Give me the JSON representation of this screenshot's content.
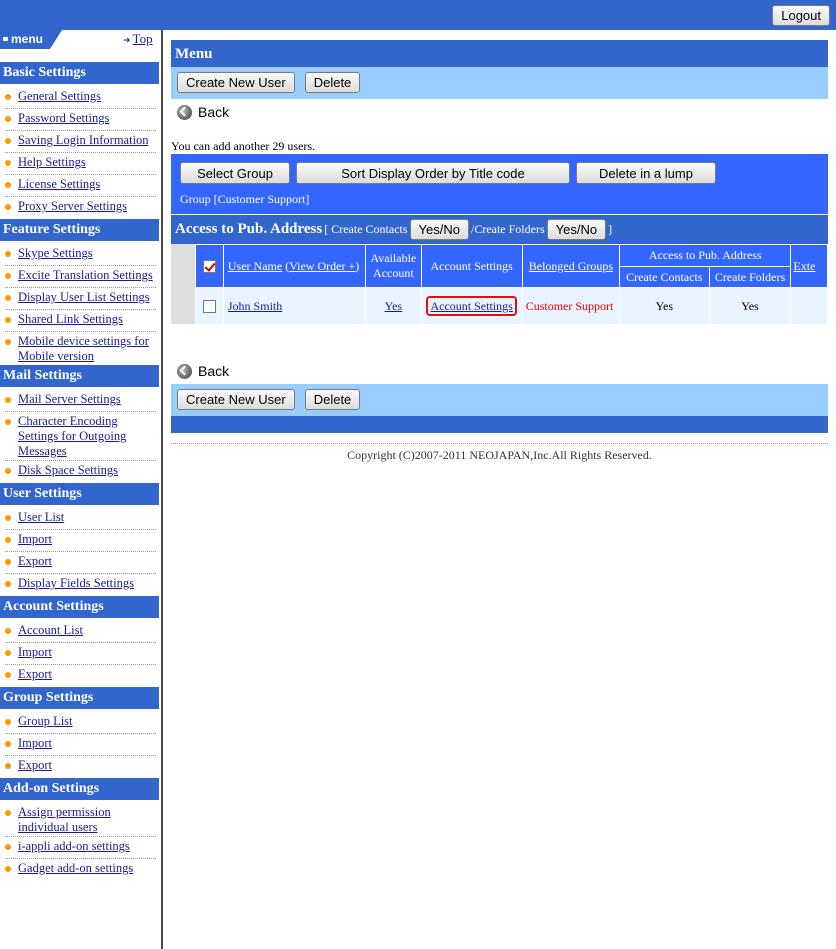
{
  "header": {
    "logout_label": "Logout"
  },
  "sidebar": {
    "menu_label": "menu",
    "top_link": "Top",
    "sections": [
      {
        "title": "Basic Settings",
        "items": [
          "General Settings",
          "Password Settings",
          "Saving Login Information",
          "Help Settings",
          "License Settings",
          "Proxy Server Settings"
        ]
      },
      {
        "title": "Feature Settings",
        "items": [
          "Skype Settings",
          "Excite Translation Settings",
          "Display User List Settings",
          "Shared Link Settings",
          "Mobile device settings for Mobile version"
        ]
      },
      {
        "title": "Mail Settings",
        "items": [
          "Mail Server Settings",
          "Character Encoding Settings for Outgoing Messages",
          "Disk Space Settings"
        ]
      },
      {
        "title": "User Settings",
        "items": [
          "User List",
          "Import",
          "Export",
          "Display Fields Settings"
        ]
      },
      {
        "title": "Account Settings",
        "items": [
          "Account List",
          "Import",
          "Export"
        ]
      },
      {
        "title": "Group Settings",
        "items": [
          "Group List",
          "Import",
          "Export"
        ]
      },
      {
        "title": "Add-on Settings",
        "items": [
          "Assign permission individual users",
          "i-appli add-on settings",
          "Gadget add-on settings"
        ]
      }
    ]
  },
  "main": {
    "title": "Menu",
    "create_user_label": "Create New User",
    "delete_label": "Delete",
    "back_label": "Back",
    "add_count_text": "You can add another 29 users.",
    "group_buttons": [
      "Select Group",
      "Sort Display Order by Title code",
      "Delete in a lump"
    ],
    "group_label": "Group [Customer Support]",
    "access": {
      "title": "Access to Pub. Address",
      "create_contacts": "[ Create Contacts",
      "yes_no": "Yes/No",
      "create_folders": "/Create Folders",
      "close_bracket": "]"
    },
    "table": {
      "headers": {
        "user_name": "User Name",
        "view_order": "(View Order +)",
        "available_account": "Available Account",
        "account_settings": "Account Settings",
        "belonged_groups": "Belonged Groups",
        "access_pub": "Access to Pub. Address",
        "create_contacts": "Create Contacts",
        "create_folders": "Create Folders",
        "extra": "Exte"
      },
      "rows": [
        {
          "user_name": "John Smith",
          "available": "Yes",
          "account_settings": "Account Settings",
          "group": "Customer Support",
          "create_contacts": "Yes",
          "create_folders": "Yes"
        }
      ]
    },
    "footer": "Copyright (C)2007-2011 NEOJAPAN,Inc.All Rights Reserved."
  },
  "colors": {
    "header_blue": "#3366cc",
    "light_blue": "#99ccff",
    "panel_blue": "#3366ff",
    "bullet": "#ff9900",
    "highlight_red": "#e01010"
  }
}
